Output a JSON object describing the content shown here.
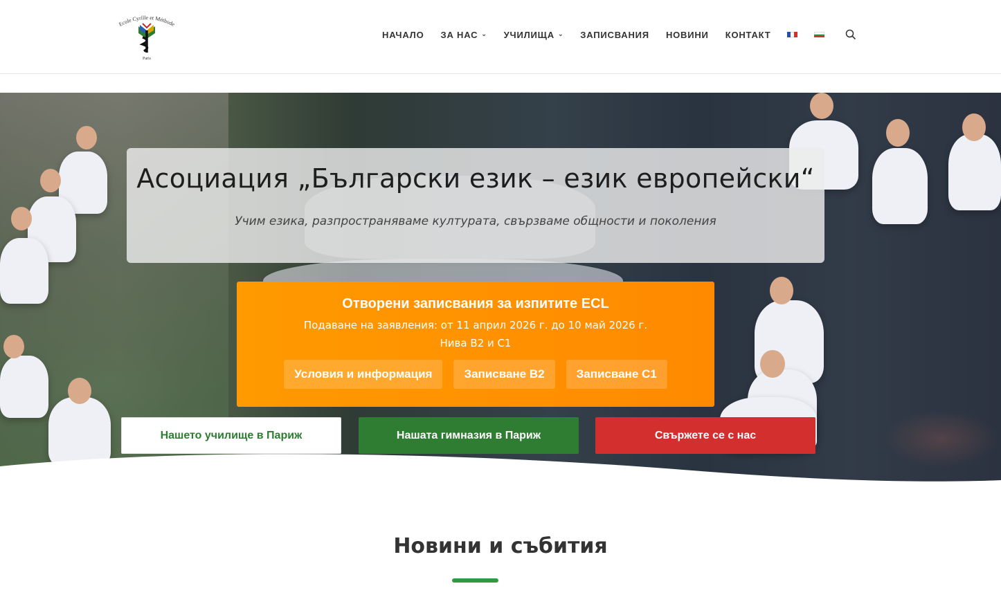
{
  "logo": {
    "name": "Ecole Cyrille et Méthode",
    "city": "Paris"
  },
  "nav": {
    "items": [
      {
        "label": "НАЧАЛО",
        "dropdown": false
      },
      {
        "label": "ЗА НАС",
        "dropdown": true
      },
      {
        "label": "УЧИЛИЩА",
        "dropdown": true
      },
      {
        "label": "ЗАПИСВАНИЯ",
        "dropdown": false
      },
      {
        "label": "НОВИНИ",
        "dropdown": false
      },
      {
        "label": "КОНТАКТ",
        "dropdown": false
      }
    ],
    "languages": [
      "fr",
      "bg"
    ],
    "search_icon": "search-icon"
  },
  "hero": {
    "title": "Асоциация „Български език – език европейски“",
    "subtitle": "Учим езика, разпространяваме културата, свързваме общности и поколения"
  },
  "ecl": {
    "heading": "Отворени записвания за изпитите ECL",
    "period": "Подаване на заявления: от 11 април 2026 г. до 10 май 2026 г.",
    "levels": "Нива B2 и C1",
    "buttons": [
      "Условия и информация",
      "Записване B2",
      "Записване C1"
    ],
    "color": "#ff9000"
  },
  "cta": {
    "school": "Нашето училище в Париж",
    "gymnasium": "Нашата гимназия в Париж",
    "contact": "Свържете се с нас"
  },
  "colors": {
    "green": "#2e7d32",
    "red": "#d32f2f",
    "orange": "#ff9000",
    "accent_bar": "#2e9a44"
  },
  "news": {
    "title": "Новини и събития"
  }
}
